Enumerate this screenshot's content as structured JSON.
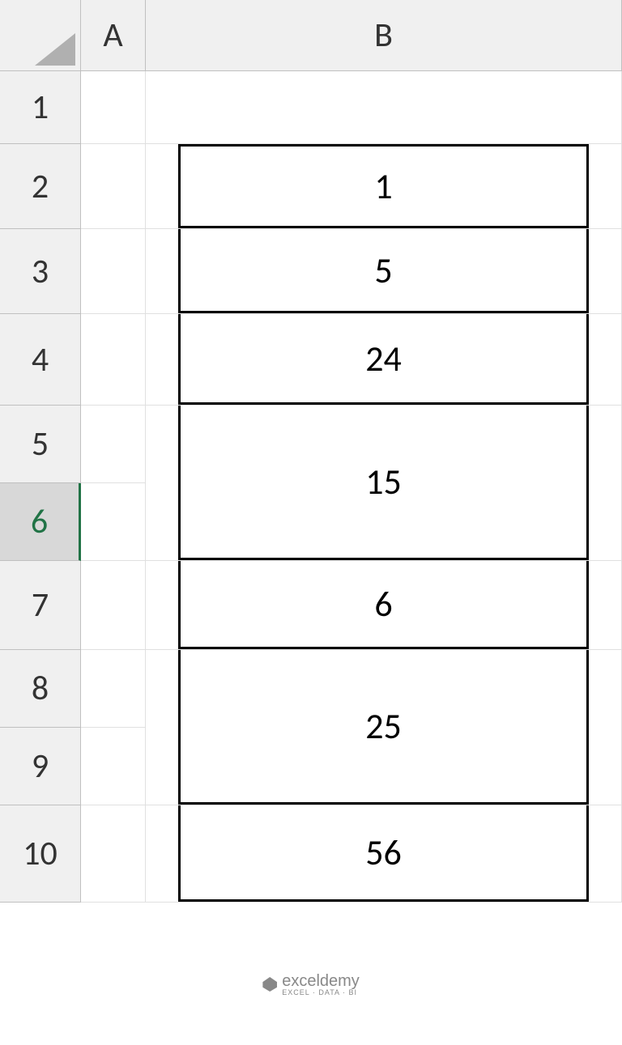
{
  "columns": [
    "A",
    "B"
  ],
  "rows": [
    "1",
    "2",
    "3",
    "4",
    "5",
    "6",
    "7",
    "8",
    "9",
    "10"
  ],
  "selectedRow": "6",
  "cells": {
    "b2": "1",
    "b3": "5",
    "b4": "24",
    "b5_6": "15",
    "b7": "6",
    "b8_9": "25",
    "b10": "56"
  },
  "watermark": {
    "name": "exceldemy",
    "tagline": "EXCEL · DATA · BI"
  }
}
